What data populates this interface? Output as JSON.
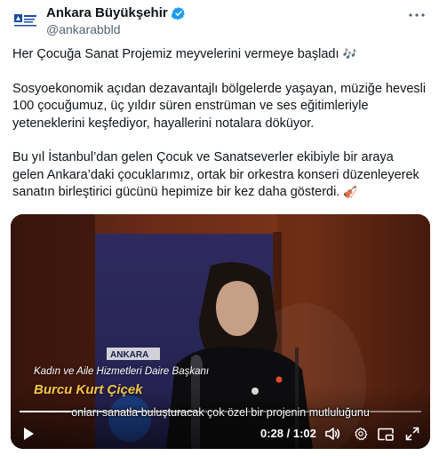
{
  "author": {
    "display_name": "Ankara Büyükşehir",
    "handle": "@ankarabbld",
    "verified_color": "#1d9bf0"
  },
  "tweet": {
    "paragraphs": [
      "Her Çocuğa Sanat Projemiz meyvelerini vermeye başladı",
      "Sosyoekonomik açıdan dezavantajlı bölgelerde yaşayan, müziğe hevesli 100 çocuğumuz, üç yıldır süren enstrüman ve ses eğitimleriyle yeteneklerini keşfediyor, hayallerini notalara döküyor.",
      "Bu yıl İstanbul’dan gelen Çocuk ve Sanatseverler ekibiyle bir araya gelen Ankara’daki çocuklarımız, ortak bir orkestra konseri düzenleyerek sanatın birleştirici gücünü hepimize bir kez daha gösterdi."
    ],
    "emoji_1": "🎶",
    "emoji_3": "🎻"
  },
  "video": {
    "lower_third_title": "Kadın ve Aile Hizmetleri Daire Başkanı",
    "lower_third_name": "Burcu Kurt Çiçek",
    "banner_text": "ANKARA",
    "subtitle": "onları sanatla buluşturacak çok özel bir projenin mutluluğunu",
    "time_current": "0:28",
    "time_total": "1:02",
    "time_display": "0:28 / 1:02",
    "progress_fraction": 0.452,
    "controls": {
      "play": "play-icon",
      "volume": "volume-icon",
      "settings": "settings-icon",
      "pip": "picture-in-picture-icon",
      "fullscreen": "fullscreen-icon"
    }
  }
}
